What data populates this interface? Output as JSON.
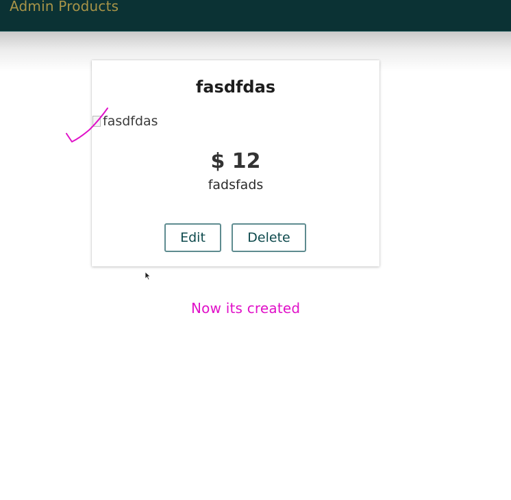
{
  "header": {
    "title": "Admin Products",
    "background": "#0b3234",
    "title_color": "#a89448"
  },
  "product_card": {
    "title": "fasdfdas",
    "image_alt": "fasdfdas",
    "price": "$ 12",
    "description": "fadsfads",
    "edit_label": "Edit",
    "delete_label": "Delete",
    "button_border_color": "#5d8b8f"
  },
  "annotation": {
    "text": "Now its created",
    "color": "#e010c8",
    "mark_icon": "checkmark-icon"
  },
  "pointer_icon": "cursor-arrow-icon"
}
